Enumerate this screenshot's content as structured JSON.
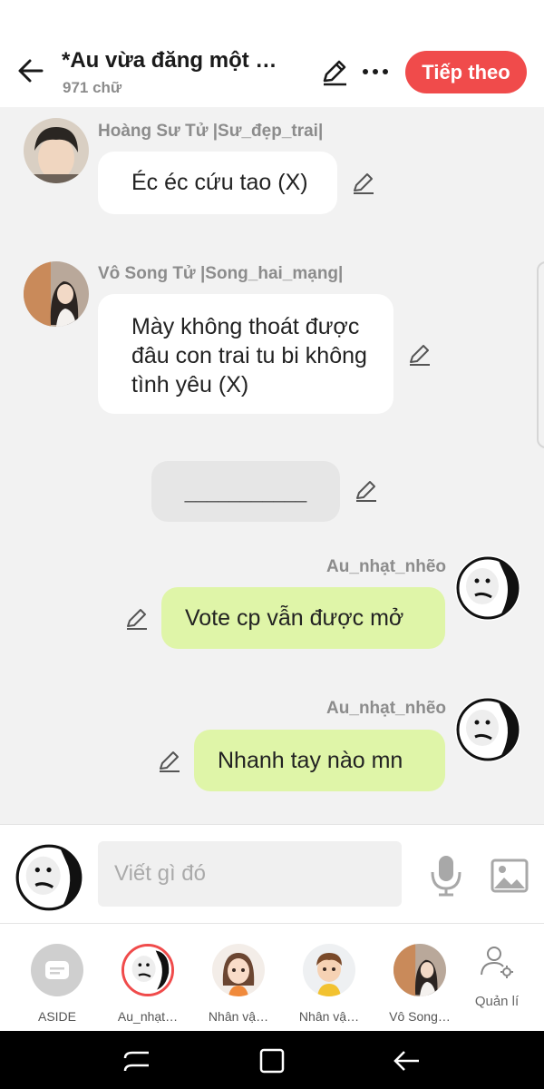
{
  "header": {
    "title": "*Au vừa đăng một bài viết",
    "word_count": "971 chữ",
    "next_label": "Tiếp theo"
  },
  "messages": [
    {
      "sender": "Hoàng Sư Tử |Sư_đẹp_trai|",
      "text": "Éc éc cứu tao (X)",
      "side": "left"
    },
    {
      "sender": "Vô Song Tử |Song_hai_mạng|",
      "text": "Mày không thoát được đâu con trai tu bi không tình yêu (X)",
      "side": "left"
    },
    {
      "sender": "",
      "text": "___________",
      "side": "center"
    },
    {
      "sender": "Au_nhạt_nhẽo",
      "text": "Vote cp vẫn được mở",
      "side": "right"
    },
    {
      "sender": "Au_nhạt_nhẽo",
      "text": "Nhanh tay nào mn",
      "side": "right"
    }
  ],
  "composer": {
    "placeholder": "Viết gì đó"
  },
  "characters": [
    {
      "label": "ASIDE"
    },
    {
      "label": "Au_nhạt…"
    },
    {
      "label": "Nhân vậ…"
    },
    {
      "label": "Nhân vậ…"
    },
    {
      "label": "Vô Song…"
    }
  ],
  "manage_label": "Quản lí",
  "colors": {
    "accent": "#f04b4b",
    "bubble_self": "#dff5a8",
    "bubble_other": "#ffffff",
    "background": "#f2f2f2"
  }
}
